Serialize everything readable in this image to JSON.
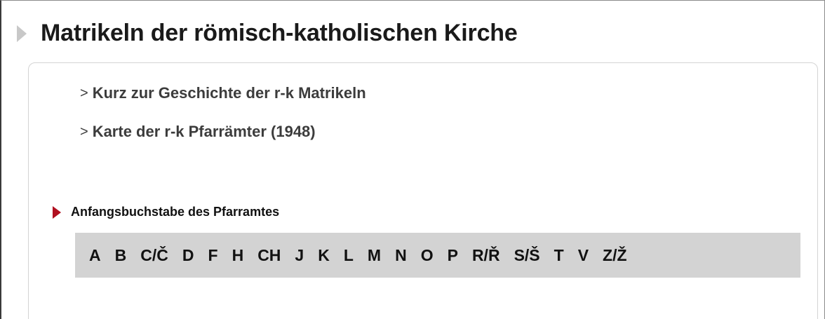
{
  "header": {
    "title": "Matrikeln der römisch-katholischen Kirche"
  },
  "links": [
    {
      "chevron": ">",
      "label": "Kurz zur Geschichte der r-k Matrikeln"
    },
    {
      "chevron": ">",
      "label": "Karte der r-k Pfarrämter (1948)"
    }
  ],
  "letter_section": {
    "label": "Anfangsbuchstabe des Pfarramtes",
    "letters": [
      "A",
      "B",
      "C/Č",
      "D",
      "F",
      "H",
      "CH",
      "J",
      "K",
      "L",
      "M",
      "N",
      "O",
      "P",
      "R/Ř",
      "S/Š",
      "T",
      "V",
      "Z/Ž"
    ]
  },
  "colors": {
    "section_arrow": "#b01020",
    "heading_arrow": "#c8c8c8",
    "letter_bar_bg": "#d3d3d3"
  }
}
